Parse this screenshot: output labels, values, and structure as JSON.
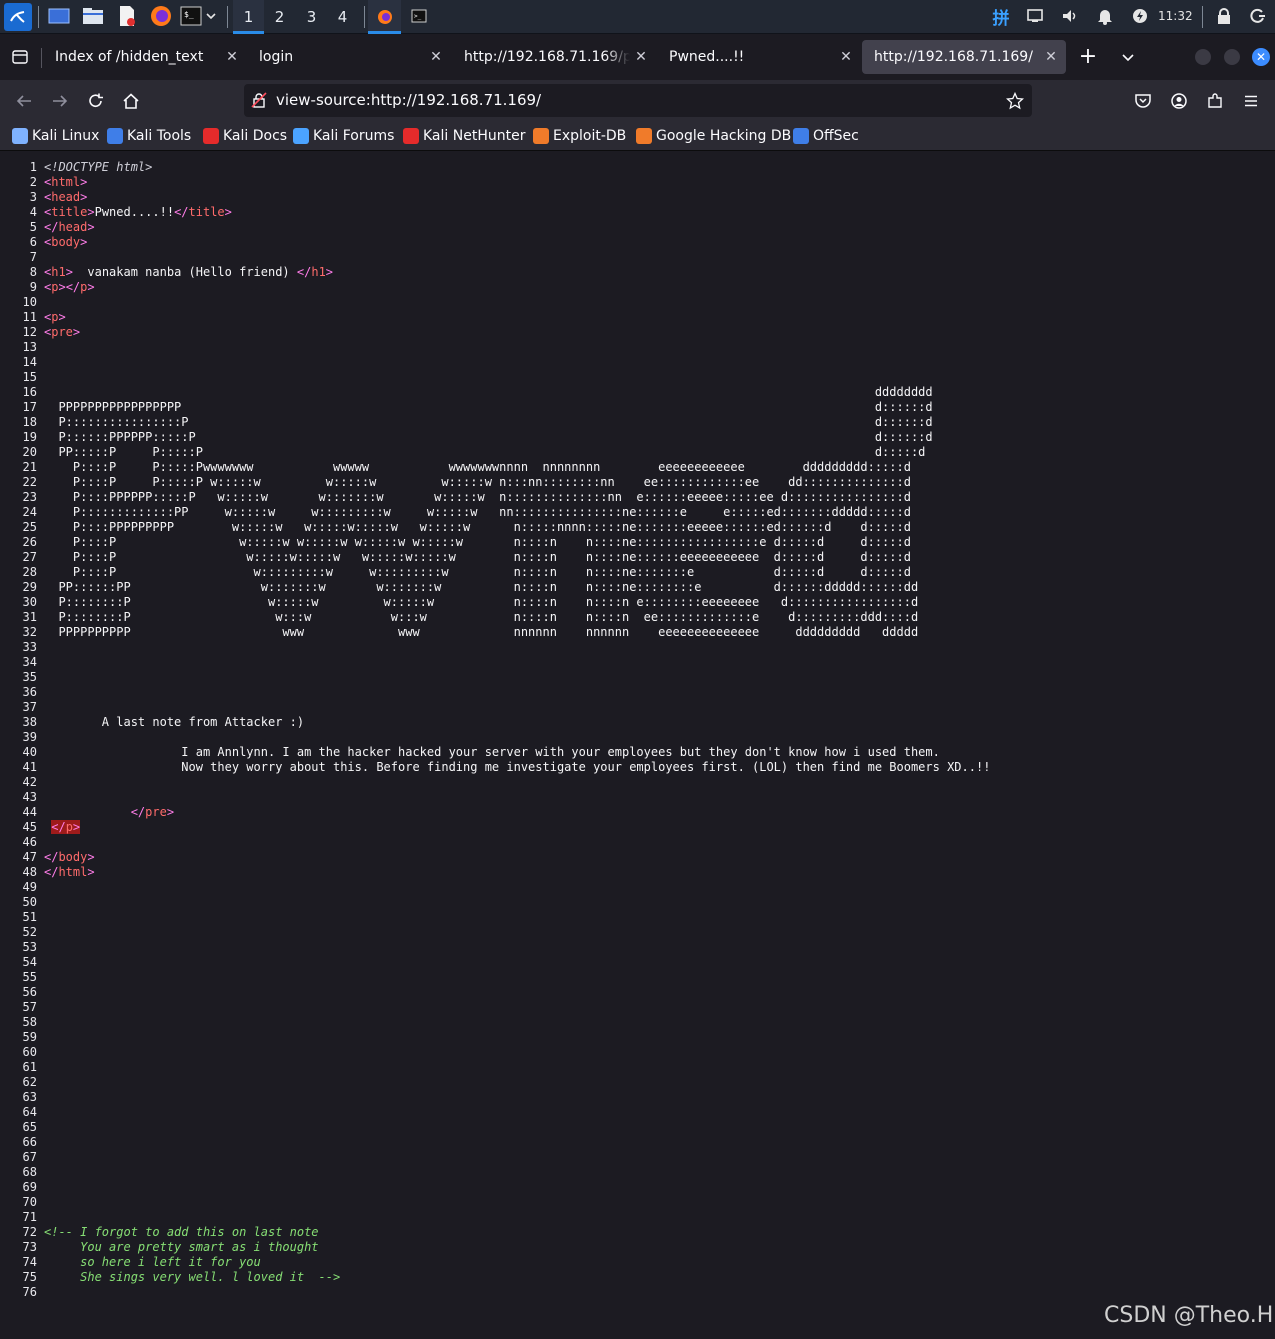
{
  "panel": {
    "workspaces": [
      "1",
      "2",
      "3",
      "4"
    ],
    "active_workspace": "1",
    "clock": "11:32",
    "icons": [
      "kali-menu-icon",
      "show-desktop-icon",
      "file-manager-icon",
      "text-editor-icon",
      "firefox-icon",
      "terminal-icon",
      "terminal-dropdown-icon",
      "firefox-window-icon",
      "terminal-window-icon",
      "input-method-icon",
      "network-icon",
      "volume-icon",
      "notification-icon",
      "power-icon",
      "lock-icon",
      "logout-icon"
    ]
  },
  "tabs": [
    {
      "label": "Index of /hidden_text"
    },
    {
      "label": "login"
    },
    {
      "label": "http://192.168.71.169/pwn"
    },
    {
      "label": "Pwned....!!"
    },
    {
      "label": "http://192.168.71.169/"
    }
  ],
  "selected_tab": 4,
  "urlbar": {
    "value": "view-source:http://192.168.71.169/"
  },
  "bookmarks": [
    {
      "label": "Kali Linux",
      "color": "#7fb2ff"
    },
    {
      "label": "Kali Tools",
      "color": "#3f7ee8"
    },
    {
      "label": "Kali Docs",
      "color": "#e52b2b"
    },
    {
      "label": "Kali Forums",
      "color": "#4ba3ff"
    },
    {
      "label": "Kali NetHunter",
      "color": "#e52b2b"
    },
    {
      "label": "Exploit-DB",
      "color": "#f07b2a"
    },
    {
      "label": "Google Hacking DB",
      "color": "#f07b2a"
    },
    {
      "label": "OffSec",
      "color": "#3f7ee8"
    }
  ],
  "source_lines": [
    [
      {
        "t": "<!DOCTYPE html>",
        "c": "dt"
      }
    ],
    [
      {
        "t": "<",
        "c": "tg"
      },
      {
        "t": "html",
        "c": "tn"
      },
      {
        "t": ">",
        "c": "tg"
      }
    ],
    [
      {
        "t": "<",
        "c": "tg"
      },
      {
        "t": "head",
        "c": "tn"
      },
      {
        "t": ">",
        "c": "tg"
      }
    ],
    [
      {
        "t": "<",
        "c": "tg"
      },
      {
        "t": "title",
        "c": "tn"
      },
      {
        "t": ">",
        "c": "tg"
      },
      {
        "t": "Pwned....!!"
      },
      {
        "t": "</",
        "c": "tg"
      },
      {
        "t": "title",
        "c": "tn"
      },
      {
        "t": ">",
        "c": "tg"
      }
    ],
    [
      {
        "t": "</",
        "c": "tg"
      },
      {
        "t": "head",
        "c": "tn"
      },
      {
        "t": ">",
        "c": "tg"
      }
    ],
    [
      {
        "t": "<",
        "c": "tg"
      },
      {
        "t": "body",
        "c": "tn"
      },
      {
        "t": ">",
        "c": "tg"
      }
    ],
    [],
    [
      {
        "t": "<",
        "c": "tg"
      },
      {
        "t": "h1",
        "c": "tn"
      },
      {
        "t": ">",
        "c": "tg"
      },
      {
        "t": "  vanakam nanba (Hello friend) "
      },
      {
        "t": "</",
        "c": "tg"
      },
      {
        "t": "h1",
        "c": "tn"
      },
      {
        "t": ">",
        "c": "tg"
      }
    ],
    [
      {
        "t": "<",
        "c": "tg"
      },
      {
        "t": "p",
        "c": "tn"
      },
      {
        "t": "></",
        "c": "tg"
      },
      {
        "t": "p",
        "c": "tn"
      },
      {
        "t": ">",
        "c": "tg"
      }
    ],
    [],
    [
      {
        "t": "<",
        "c": "tg"
      },
      {
        "t": "p",
        "c": "tn"
      },
      {
        "t": ">",
        "c": "tg"
      }
    ],
    [
      {
        "t": "<",
        "c": "tg"
      },
      {
        "t": "pre",
        "c": "tn"
      },
      {
        "t": ">",
        "c": "tg"
      }
    ],
    [],
    [],
    [],
    [
      {
        "t": "                                                                                                                   dddddddd"
      }
    ],
    [
      {
        "t": "  PPPPPPPPPPPPPPPPP                                                                                                d::::::d"
      }
    ],
    [
      {
        "t": "  P::::::::::::::::P                                                                                               d::::::d"
      }
    ],
    [
      {
        "t": "  P::::::PPPPPP:::::P                                                                                              d::::::d"
      }
    ],
    [
      {
        "t": "  PP:::::P     P:::::P                                                                                             d:::::d"
      }
    ],
    [
      {
        "t": "    P::::P     P:::::Pwwwwwww           wwwww           wwwwwwwnnnn  nnnnnnnn        eeeeeeeeeeee        ddddddddd:::::d"
      }
    ],
    [
      {
        "t": "    P::::P     P:::::P w:::::w         w:::::w         w:::::w n:::nn::::::::nn    ee::::::::::::ee    dd::::::::::::::d"
      }
    ],
    [
      {
        "t": "    P::::PPPPPP:::::P   w:::::w       w:::::::w       w:::::w  n::::::::::::::nn  e::::::eeeee:::::ee d::::::::::::::::d"
      }
    ],
    [
      {
        "t": "    P:::::::::::::PP     w:::::w     w:::::::::w     w:::::w   nn:::::::::::::::ne::::::e     e:::::ed:::::::ddddd:::::d"
      }
    ],
    [
      {
        "t": "    P::::PPPPPPPPP        w:::::w   w:::::w:::::w   w:::::w      n:::::nnnn:::::ne:::::::eeeee::::::ed::::::d    d:::::d"
      }
    ],
    [
      {
        "t": "    P::::P                 w:::::w w:::::w w:::::w w:::::w       n::::n    n::::ne:::::::::::::::::e d:::::d     d:::::d"
      }
    ],
    [
      {
        "t": "    P::::P                  w:::::w:::::w   w:::::w:::::w        n::::n    n::::ne::::::eeeeeeeeeee  d:::::d     d:::::d"
      }
    ],
    [
      {
        "t": "    P::::P                   w:::::::::w     w:::::::::w         n::::n    n::::ne:::::::e           d:::::d     d:::::d"
      }
    ],
    [
      {
        "t": "  PP::::::PP                  w:::::::w       w:::::::w          n::::n    n::::ne::::::::e          d::::::ddddd::::::dd"
      }
    ],
    [
      {
        "t": "  P::::::::P                   w:::::w         w:::::w           n::::n    n::::n e::::::::eeeeeeee   d:::::::::::::::::d"
      }
    ],
    [
      {
        "t": "  P::::::::P                    w:::w           w:::w            n::::n    n::::n  ee:::::::::::::e    d:::::::::ddd::::d"
      }
    ],
    [
      {
        "t": "  PPPPPPPPPP                     www             www             nnnnnn    nnnnnn    eeeeeeeeeeeeee     ddddddddd   ddddd"
      }
    ],
    [],
    [],
    [],
    [],
    [],
    [
      {
        "t": "        A last note from Attacker :)"
      }
    ],
    [],
    [
      {
        "t": "                   I am Annlynn. I am the hacker hacked your server with your employees but they don't know how i used them."
      }
    ],
    [
      {
        "t": "                   Now they worry about this. Before finding me investigate your employees first. (LOL) then find me Boomers XD..!!"
      }
    ],
    [],
    [],
    [
      {
        "t": "            "
      },
      {
        "t": "</",
        "c": "tg"
      },
      {
        "t": "pre",
        "c": "tn"
      },
      {
        "t": ">",
        "c": "tg"
      }
    ],
    [
      {
        "t": " "
      },
      {
        "t": "</",
        "c": "tg hl"
      },
      {
        "t": "p",
        "c": "tn hl"
      },
      {
        "t": ">",
        "c": "tg hl"
      }
    ],
    [],
    [
      {
        "t": "</",
        "c": "tg"
      },
      {
        "t": "body",
        "c": "tn"
      },
      {
        "t": ">",
        "c": "tg"
      }
    ],
    [
      {
        "t": "</",
        "c": "tg"
      },
      {
        "t": "html",
        "c": "tn"
      },
      {
        "t": ">",
        "c": "tg"
      }
    ],
    [],
    [],
    [],
    [],
    [],
    [],
    [],
    [],
    [],
    [],
    [],
    [],
    [],
    [],
    [],
    [],
    [],
    [],
    [],
    [],
    [],
    [],
    [],
    [
      {
        "t": "<!-- I forgot to add this on last note",
        "c": "cm"
      }
    ],
    [
      {
        "t": "     You are pretty smart as i thought",
        "c": "cm"
      }
    ],
    [
      {
        "t": "     so here i left it for you",
        "c": "cm"
      }
    ],
    [
      {
        "t": "     She sings very well. l loved it  -->",
        "c": "cm"
      }
    ],
    []
  ],
  "watermark": "CSDN @Theo.H"
}
